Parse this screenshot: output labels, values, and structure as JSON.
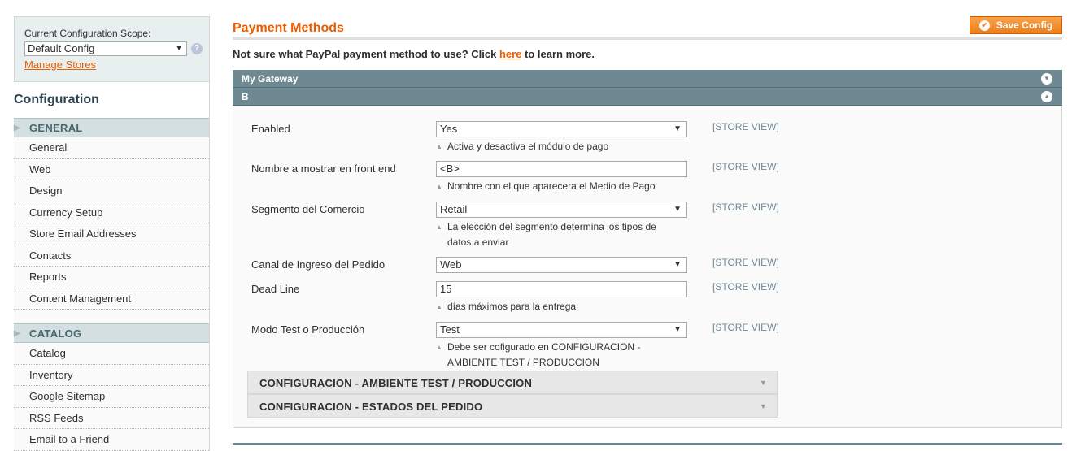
{
  "scope": {
    "label": "Current Configuration Scope:",
    "selected": "Default Config",
    "help": "?",
    "manage_link": "Manage Stores"
  },
  "sidebar": {
    "title": "Configuration",
    "groups": [
      {
        "label": "GENERAL",
        "items": [
          "General",
          "Web",
          "Design",
          "Currency Setup",
          "Store Email Addresses",
          "Contacts",
          "Reports",
          "Content Management"
        ]
      },
      {
        "label": "CATALOG",
        "items": [
          "Catalog",
          "Inventory",
          "Google Sitemap",
          "RSS Feeds",
          "Email to a Friend"
        ]
      }
    ]
  },
  "main": {
    "title": "Payment Methods",
    "save_label": "Save Config",
    "notice_before": "Not sure what PayPal payment method to use? Click ",
    "notice_link": "here",
    "notice_after": " to learn more.",
    "sections": [
      {
        "label": "My Gateway",
        "toggle": "▼"
      },
      {
        "label": "B",
        "toggle": "▲"
      }
    ]
  },
  "fields": [
    {
      "label": "Enabled",
      "value": "Yes",
      "type": "select",
      "scope": "[STORE VIEW]",
      "note": "Activa y desactiva el módulo de pago"
    },
    {
      "label": "Nombre a mostrar en front end",
      "value": "<B>",
      "type": "text",
      "scope": "[STORE VIEW]",
      "note": "Nombre con el que aparecera el Medio de Pago"
    },
    {
      "label": "Segmento del Comercio",
      "value": "Retail",
      "type": "select",
      "scope": "[STORE VIEW]",
      "note": "La elección del segmento determina los tipos de datos a enviar"
    },
    {
      "label": "Canal de Ingreso del Pedido",
      "value": "Web",
      "type": "select",
      "scope": "[STORE VIEW]",
      "note": ""
    },
    {
      "label": "Dead Line",
      "value": "15",
      "type": "text",
      "scope": "[STORE VIEW]",
      "note": "días máximos para la entrega"
    },
    {
      "label": "Modo Test o Producción",
      "value": "Test",
      "type": "select",
      "scope": "[STORE VIEW]",
      "note": "Debe ser cofigurado en CONFIGURACION - AMBIENTE TEST / PRODUCCION"
    }
  ],
  "subgroups": [
    "CONFIGURACION - AMBIENTE TEST / PRODUCCION",
    "CONFIGURACION - ESTADOS DEL PEDIDO"
  ],
  "icons": {
    "select_arrow": "▼",
    "note_tip": "▲",
    "group_tri": "▶",
    "subgroup_arrow": "▼",
    "save_check": "✔"
  }
}
